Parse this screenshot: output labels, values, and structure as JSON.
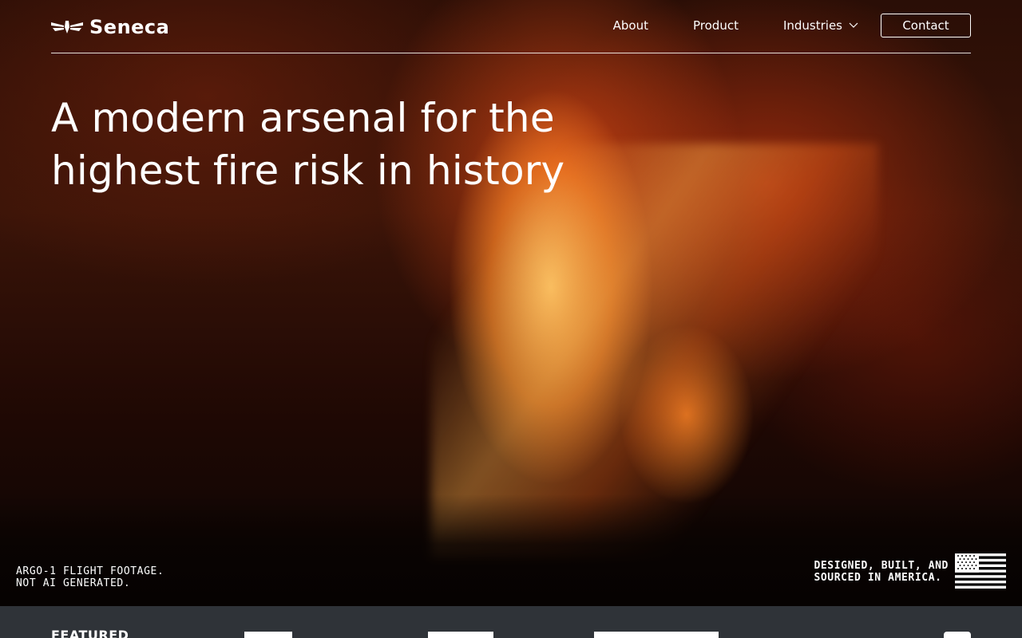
{
  "brand": {
    "name": "Seneca"
  },
  "nav": {
    "items": [
      {
        "label": "About"
      },
      {
        "label": "Product"
      },
      {
        "label": "Industries"
      }
    ],
    "contact_label": "Contact"
  },
  "hero": {
    "headline_line1": "A modern arsenal for the",
    "headline_line2": "highest fire risk in history",
    "caption_left_line1": "ARGO-1 FLIGHT FOOTAGE.",
    "caption_left_line2": "NOT AI GENERATED.",
    "caption_right_line1": "DESIGNED, BUILT, AND",
    "caption_right_line2": "SOURCED IN AMERICA."
  },
  "featured": {
    "label": "FEATURED"
  },
  "colors": {
    "featured_bar": "#2f3338",
    "text": "#ffffff",
    "fire_glow": "#ff8c28"
  },
  "icons": {
    "logo": "seneca-wing-logo-icon",
    "industries_dropdown": "chevron-down-icon",
    "flag": "american-flag-icon"
  }
}
